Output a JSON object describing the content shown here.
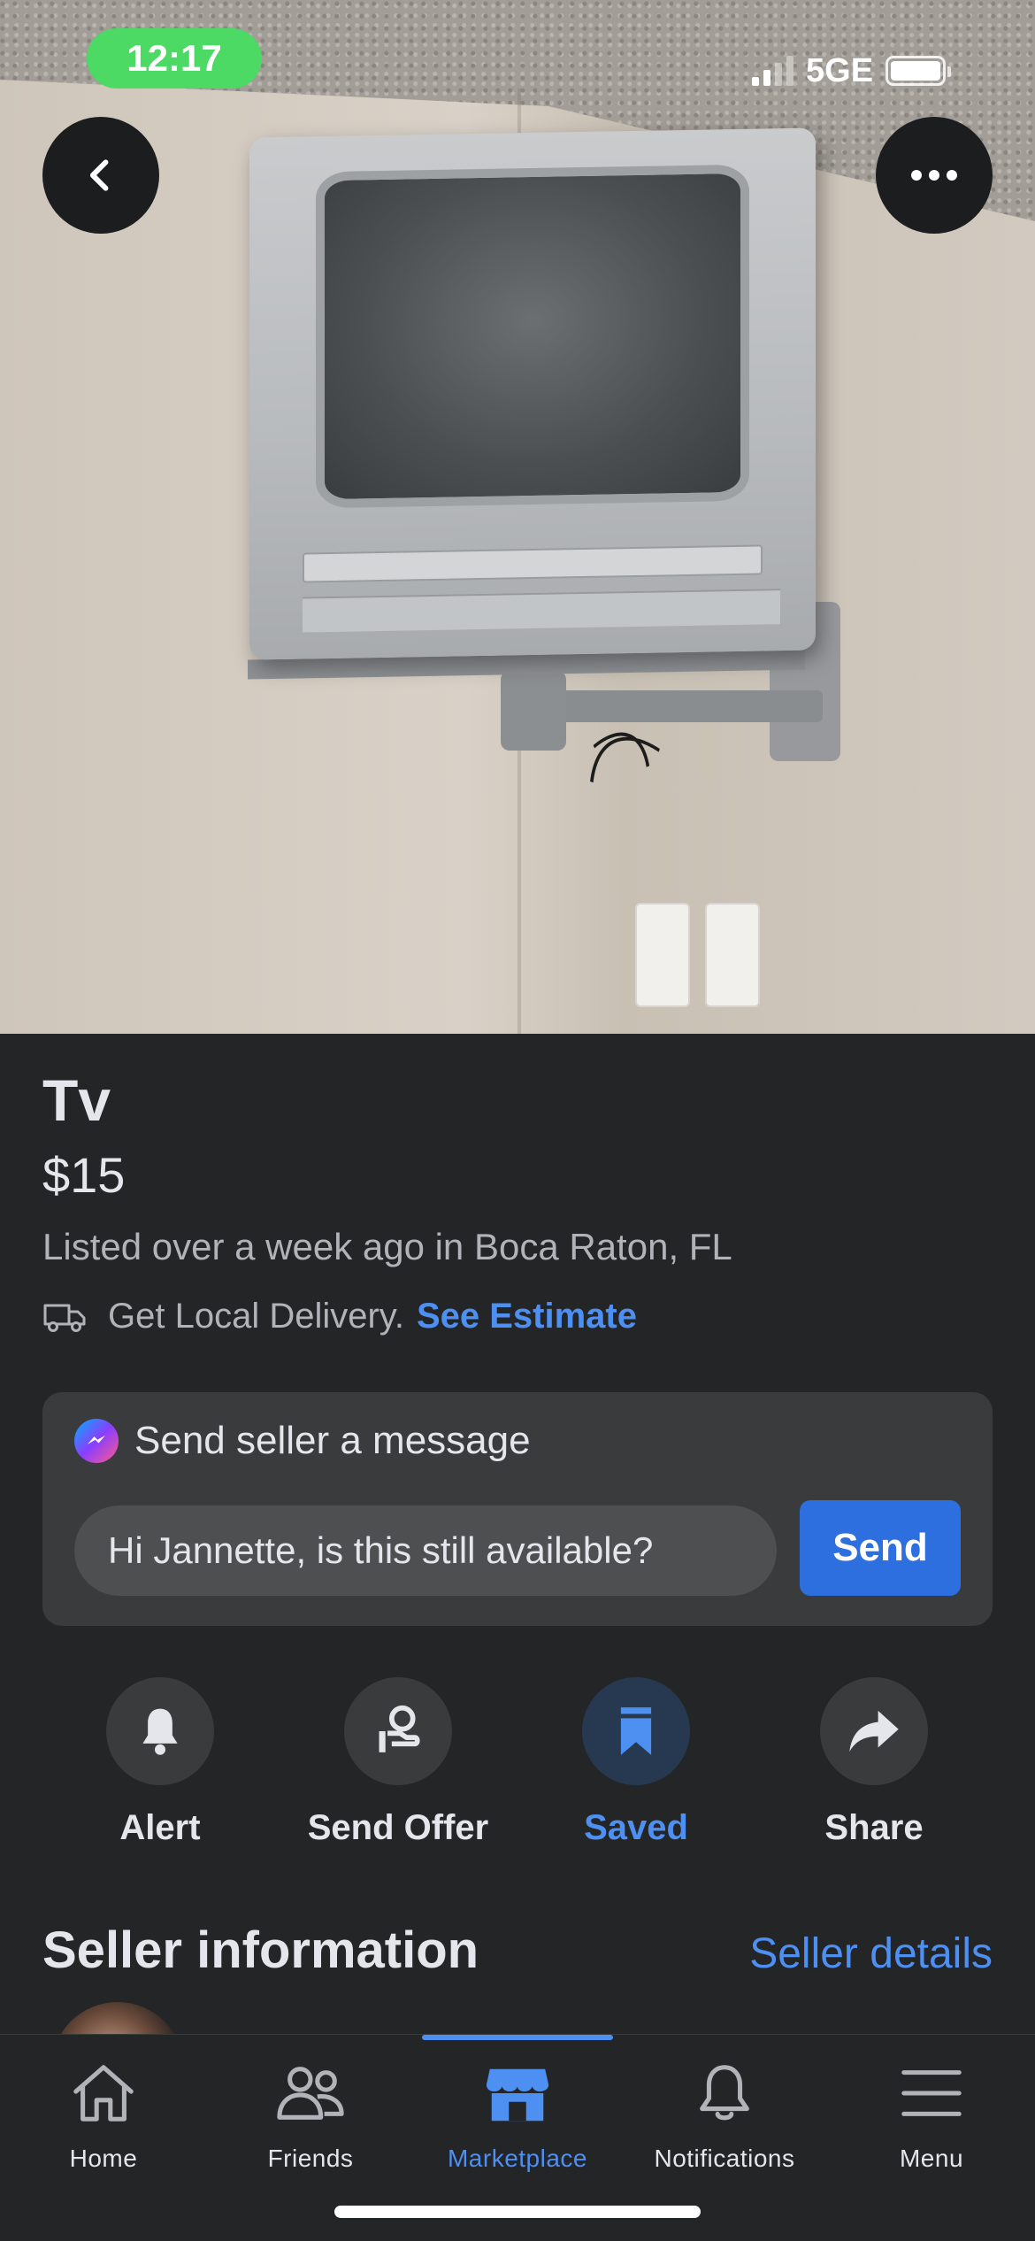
{
  "status_bar": {
    "time": "12:17",
    "network": "5GE",
    "signal_bars_active": 2,
    "signal_bars_total": 4
  },
  "photo": {
    "description_icon_back": "chevron-left-icon",
    "description_icon_more": "ellipsis-icon"
  },
  "listing": {
    "title": "Tv",
    "price": "$15",
    "listed": "Listed over a week ago in Boca Raton, FL",
    "delivery_text": "Get Local Delivery.",
    "delivery_link": "See Estimate"
  },
  "message": {
    "header": "Send seller a message",
    "input_value": "Hi Jannette, is this still available?",
    "send_label": "Send"
  },
  "actions": [
    {
      "label": "Alert",
      "icon": "bell-icon",
      "active": false
    },
    {
      "label": "Send Offer",
      "icon": "offer-hand-icon",
      "active": false
    },
    {
      "label": "Saved",
      "icon": "bookmark-icon",
      "active": true
    },
    {
      "label": "Share",
      "icon": "share-arrow-icon",
      "active": false
    }
  ],
  "seller": {
    "heading": "Seller information",
    "details_link": "Seller details"
  },
  "nav": {
    "items": [
      {
        "label": "Home",
        "icon": "home-icon"
      },
      {
        "label": "Friends",
        "icon": "friends-icon"
      },
      {
        "label": "Marketplace",
        "icon": "marketplace-icon"
      },
      {
        "label": "Notifications",
        "icon": "bell-outline-icon"
      },
      {
        "label": "Menu",
        "icon": "hamburger-icon"
      }
    ],
    "active": "Marketplace"
  },
  "colors": {
    "accent": "#4e8ff2",
    "background": "#242526",
    "card": "#3a3b3c",
    "send_button": "#2d6fde",
    "status_pill": "#4cd964"
  }
}
